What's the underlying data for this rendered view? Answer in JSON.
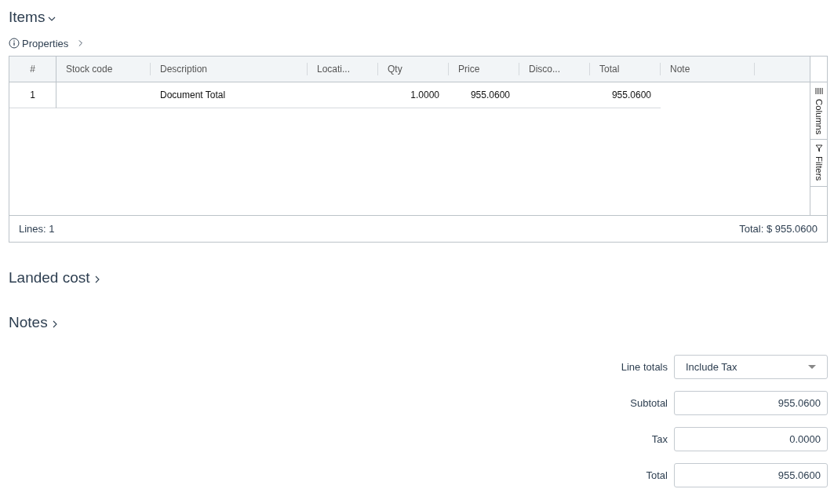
{
  "items_section": {
    "title": "Items",
    "expanded": true
  },
  "properties_link": {
    "label": "Properties"
  },
  "table": {
    "columns": [
      "#",
      "Stock code",
      "Description",
      "Locati...",
      "Qty",
      "Price",
      "Disco...",
      "Total",
      "Note"
    ],
    "rows": [
      {
        "cells": [
          "1",
          "",
          "Document Total",
          "",
          "1.0000",
          "955.0600",
          "",
          "955.0600",
          ""
        ]
      }
    ],
    "side_tabs": [
      {
        "label": "Columns",
        "kind": "columns"
      },
      {
        "label": "Filters",
        "kind": "filters"
      }
    ],
    "footer": {
      "lines": "Lines: 1",
      "total": "Total: $ 955.0600"
    }
  },
  "collapsed_sections": [
    {
      "title": "Landed cost",
      "expanded": false
    },
    {
      "title": "Notes",
      "expanded": false
    }
  ],
  "totals": {
    "line_totals": {
      "label": "Line totals",
      "value": "Include Tax"
    },
    "fields": [
      {
        "label": "Subtotal",
        "value": "955.0600"
      },
      {
        "label": "Tax",
        "value": "0.0000"
      },
      {
        "label": "Total",
        "value": "955.0600"
      }
    ]
  }
}
